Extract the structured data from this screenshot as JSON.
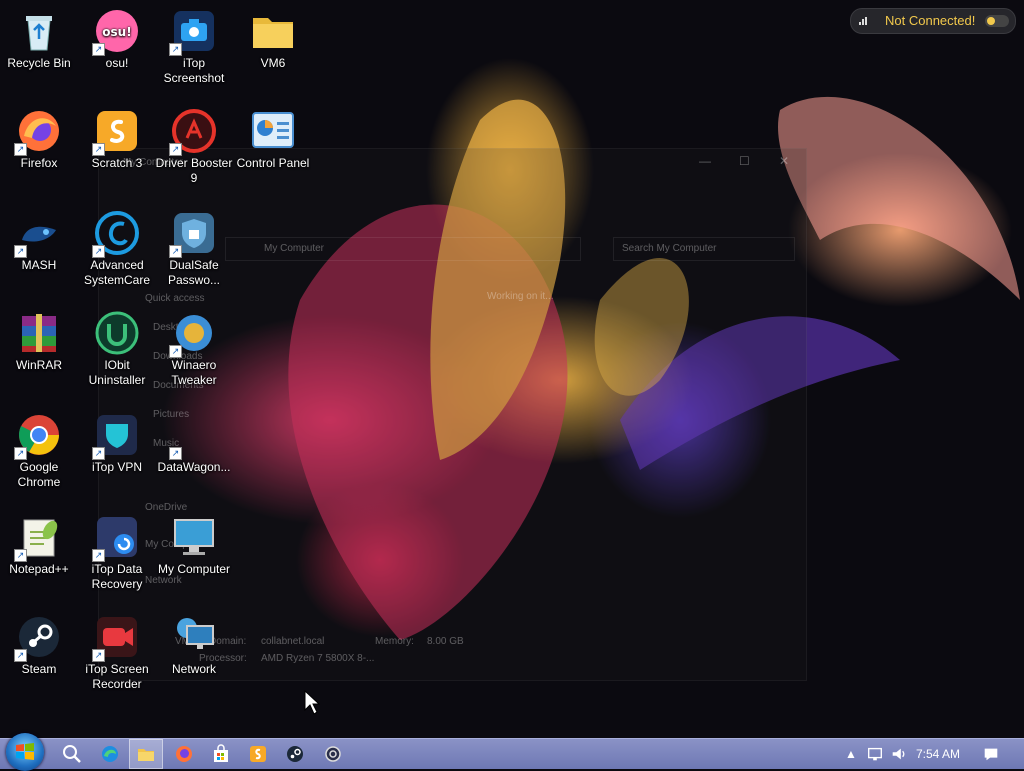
{
  "desktop": {
    "icons": [
      {
        "label": "Recycle Bin",
        "icon": "recycle-bin-icon"
      },
      {
        "label": "osu!",
        "icon": "osu-icon"
      },
      {
        "label": "iTop Screenshot",
        "icon": "camera-icon"
      },
      {
        "label": "VM6",
        "icon": "folder-icon"
      },
      {
        "label": "Firefox",
        "icon": "firefox-icon"
      },
      {
        "label": "Scratch 3",
        "icon": "scratch-icon"
      },
      {
        "label": "Driver Booster 9",
        "icon": "driver-booster-icon"
      },
      {
        "label": "Control Panel",
        "icon": "control-panel-icon"
      },
      {
        "label": "MASH",
        "icon": "mash-icon"
      },
      {
        "label": "Advanced SystemCare",
        "icon": "advanced-systemcare-icon"
      },
      {
        "label": "DualSafe Passwo...",
        "icon": "lock-icon"
      },
      {
        "label": "WinRAR",
        "icon": "winrar-icon"
      },
      {
        "label": "IObit Uninstaller",
        "icon": "uninstaller-icon"
      },
      {
        "label": "Winaero Tweaker",
        "icon": "tweaker-icon"
      },
      {
        "label": "Google Chrome",
        "icon": "chrome-icon"
      },
      {
        "label": "iTop VPN",
        "icon": "vpn-icon"
      },
      {
        "label": "DataWagon...",
        "icon": "document-icon"
      },
      {
        "label": "Notepad++",
        "icon": "notepad-icon"
      },
      {
        "label": "iTop Data Recovery",
        "icon": "data-recovery-icon"
      },
      {
        "label": "My Computer",
        "icon": "computer-icon"
      },
      {
        "label": "Steam",
        "icon": "steam-icon"
      },
      {
        "label": "iTop Screen Recorder",
        "icon": "screen-recorder-icon"
      },
      {
        "label": "Network",
        "icon": "network-icon"
      }
    ]
  },
  "ghost_window": {
    "title": "My Computer",
    "address": "My Computer",
    "search_placeholder": "Search My Computer",
    "status": "Working on it...",
    "sidebar": {
      "quick_access": "Quick access",
      "items": [
        "Desktop",
        "Downloads",
        "Documents",
        "Pictures",
        "Music"
      ],
      "onedrive": "OneDrive",
      "my_computer": "My Computer",
      "network": "Network"
    },
    "details": {
      "name": "VM6",
      "domain_label": "Domain:",
      "domain_value": "collabnet.local",
      "memory_label": "Memory:",
      "memory_value": "8.00 GB",
      "processor_label": "Processor:",
      "processor_value": "AMD Ryzen 7 5800X 8-..."
    }
  },
  "vpn_status": {
    "label": "Not Connected!",
    "color": "#f2c94c"
  },
  "taskbar": {
    "start_icon": "windows-start-icon",
    "pinned": [
      {
        "icon": "search-icon"
      },
      {
        "icon": "edge-icon"
      },
      {
        "icon": "file-explorer-icon"
      },
      {
        "icon": "firefox-icon"
      },
      {
        "icon": "store-icon"
      },
      {
        "icon": "scratch-icon"
      },
      {
        "icon": "steam-icon"
      },
      {
        "icon": "settings-icon"
      }
    ],
    "tray": {
      "clock": "7:54 AM"
    }
  }
}
